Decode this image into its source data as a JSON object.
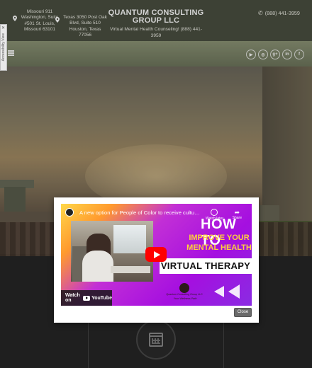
{
  "header": {
    "address1": "Missouri 911 Washington, Suite #501 St. Louis, Missouri 63101",
    "address2": "Texas 3050 Post Oak Blvd, Suite 510 Houston, Texas 77056",
    "company_name": "QUANTUM CONSULTING GROUP LLC",
    "company_sub": "Virtual Mental Health Counseling! (888) 441-3959",
    "phone": "(888) 441-3959"
  },
  "accessibility": {
    "close": "✕",
    "label": "Accessibility View"
  },
  "nav": {
    "socials": [
      {
        "icon": "youtube-icon",
        "glyph": "▶"
      },
      {
        "icon": "instagram-icon",
        "glyph": "◎"
      },
      {
        "icon": "google-plus-icon",
        "glyph": "g+"
      },
      {
        "icon": "linkedin-icon",
        "glyph": "in"
      },
      {
        "icon": "facebook-icon",
        "glyph": "f"
      }
    ]
  },
  "modal": {
    "video_title": "A new option for People of Color to receive cultura...",
    "watch_later": "Watch later",
    "share": "Share",
    "headline1": "HOW TO",
    "headline2": "IMPROVE YOUR MENTAL HEALTH",
    "headline3": "VIRTUAL THERAPY",
    "logo_text": "Quantum Consulting Group LLC",
    "logo_tag": "Your Wellness Path",
    "watch_on": "Watch on",
    "youtube": "YouTube",
    "close_label": "Close"
  },
  "colors": {
    "header_bg": "#4b5041",
    "navbar": "#7b8266",
    "play_red": "#ff0000",
    "video_purple": "#a50fe0"
  }
}
